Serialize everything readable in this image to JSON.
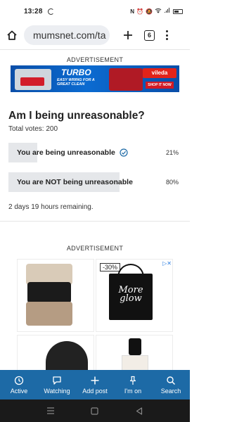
{
  "status_bar": {
    "time": "13:28"
  },
  "browser": {
    "url": "mumsnet.com/ta",
    "tab_count": "6"
  },
  "ads": {
    "top_label": "ADVERTISEMENT",
    "mid_label": "ADVERTISEMENT"
  },
  "banner_ad": {
    "headline": "TURBO",
    "tagline": "EASY WRING FOR A GREAT CLEAN",
    "brand": "vileda",
    "cta": "SHOP IT NOW"
  },
  "poll": {
    "title": "Am I being unreasonable?",
    "total_votes": "Total votes: 200",
    "options": [
      {
        "label": "You are being unreasonable",
        "percent": "21%",
        "share": 0.21,
        "voted": true
      },
      {
        "label": "You are NOT being unreasonable",
        "percent": "80%",
        "share": 0.8,
        "voted": false
      }
    ],
    "remaining": "2 days 19 hours remaining."
  },
  "product_ad": {
    "discount": "-30%",
    "tote_text": "More glow",
    "adchoice": "▷✕"
  },
  "bottom_nav": {
    "items": [
      {
        "label": "Active",
        "icon": "clock-icon"
      },
      {
        "label": "Watching",
        "icon": "chat-bubble-icon"
      },
      {
        "label": "Add post",
        "icon": "plus-icon"
      },
      {
        "label": "I'm on",
        "icon": "pin-icon"
      },
      {
        "label": "Search",
        "icon": "search-icon"
      }
    ]
  },
  "colors": {
    "nav_blue": "#1d6aa6",
    "poll_bar": "#e5e7ea",
    "check_blue": "#1d6aa6"
  }
}
